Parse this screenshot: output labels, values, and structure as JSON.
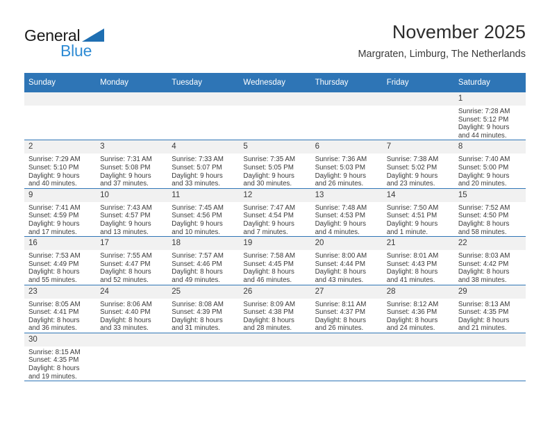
{
  "brand": {
    "name_top": "General",
    "name_bottom": "Blue",
    "accent_color": "#2e8bd4",
    "flag_color": "#1f6fb2"
  },
  "header": {
    "title": "November 2025",
    "subtitle": "Margraten, Limburg, The Netherlands"
  },
  "theme": {
    "header_blue": "#2e75b6",
    "daynum_band": "#f1f1f1",
    "text": "#3a3a3a"
  },
  "weekday_headers": [
    "Sunday",
    "Monday",
    "Tuesday",
    "Wednesday",
    "Thursday",
    "Friday",
    "Saturday"
  ],
  "labels": {
    "sunrise_prefix": "Sunrise:",
    "sunset_prefix": "Sunset:",
    "daylight_prefix": "Daylight:"
  },
  "weeks": [
    [
      {
        "day": "",
        "sunrise": "",
        "sunset": "",
        "daylight_1": "",
        "daylight_2": "",
        "empty": true
      },
      {
        "day": "",
        "sunrise": "",
        "sunset": "",
        "daylight_1": "",
        "daylight_2": "",
        "empty": true
      },
      {
        "day": "",
        "sunrise": "",
        "sunset": "",
        "daylight_1": "",
        "daylight_2": "",
        "empty": true
      },
      {
        "day": "",
        "sunrise": "",
        "sunset": "",
        "daylight_1": "",
        "daylight_2": "",
        "empty": true
      },
      {
        "day": "",
        "sunrise": "",
        "sunset": "",
        "daylight_1": "",
        "daylight_2": "",
        "empty": true
      },
      {
        "day": "",
        "sunrise": "",
        "sunset": "",
        "daylight_1": "",
        "daylight_2": "",
        "empty": true
      },
      {
        "day": "1",
        "sunrise": "Sunrise: 7:28 AM",
        "sunset": "Sunset: 5:12 PM",
        "daylight_1": "Daylight: 9 hours",
        "daylight_2": "and 44 minutes.",
        "empty": false
      }
    ],
    [
      {
        "day": "2",
        "sunrise": "Sunrise: 7:29 AM",
        "sunset": "Sunset: 5:10 PM",
        "daylight_1": "Daylight: 9 hours",
        "daylight_2": "and 40 minutes.",
        "empty": false
      },
      {
        "day": "3",
        "sunrise": "Sunrise: 7:31 AM",
        "sunset": "Sunset: 5:08 PM",
        "daylight_1": "Daylight: 9 hours",
        "daylight_2": "and 37 minutes.",
        "empty": false
      },
      {
        "day": "4",
        "sunrise": "Sunrise: 7:33 AM",
        "sunset": "Sunset: 5:07 PM",
        "daylight_1": "Daylight: 9 hours",
        "daylight_2": "and 33 minutes.",
        "empty": false
      },
      {
        "day": "5",
        "sunrise": "Sunrise: 7:35 AM",
        "sunset": "Sunset: 5:05 PM",
        "daylight_1": "Daylight: 9 hours",
        "daylight_2": "and 30 minutes.",
        "empty": false
      },
      {
        "day": "6",
        "sunrise": "Sunrise: 7:36 AM",
        "sunset": "Sunset: 5:03 PM",
        "daylight_1": "Daylight: 9 hours",
        "daylight_2": "and 26 minutes.",
        "empty": false
      },
      {
        "day": "7",
        "sunrise": "Sunrise: 7:38 AM",
        "sunset": "Sunset: 5:02 PM",
        "daylight_1": "Daylight: 9 hours",
        "daylight_2": "and 23 minutes.",
        "empty": false
      },
      {
        "day": "8",
        "sunrise": "Sunrise: 7:40 AM",
        "sunset": "Sunset: 5:00 PM",
        "daylight_1": "Daylight: 9 hours",
        "daylight_2": "and 20 minutes.",
        "empty": false
      }
    ],
    [
      {
        "day": "9",
        "sunrise": "Sunrise: 7:41 AM",
        "sunset": "Sunset: 4:59 PM",
        "daylight_1": "Daylight: 9 hours",
        "daylight_2": "and 17 minutes.",
        "empty": false
      },
      {
        "day": "10",
        "sunrise": "Sunrise: 7:43 AM",
        "sunset": "Sunset: 4:57 PM",
        "daylight_1": "Daylight: 9 hours",
        "daylight_2": "and 13 minutes.",
        "empty": false
      },
      {
        "day": "11",
        "sunrise": "Sunrise: 7:45 AM",
        "sunset": "Sunset: 4:56 PM",
        "daylight_1": "Daylight: 9 hours",
        "daylight_2": "and 10 minutes.",
        "empty": false
      },
      {
        "day": "12",
        "sunrise": "Sunrise: 7:47 AM",
        "sunset": "Sunset: 4:54 PM",
        "daylight_1": "Daylight: 9 hours",
        "daylight_2": "and 7 minutes.",
        "empty": false
      },
      {
        "day": "13",
        "sunrise": "Sunrise: 7:48 AM",
        "sunset": "Sunset: 4:53 PM",
        "daylight_1": "Daylight: 9 hours",
        "daylight_2": "and 4 minutes.",
        "empty": false
      },
      {
        "day": "14",
        "sunrise": "Sunrise: 7:50 AM",
        "sunset": "Sunset: 4:51 PM",
        "daylight_1": "Daylight: 9 hours",
        "daylight_2": "and 1 minute.",
        "empty": false
      },
      {
        "day": "15",
        "sunrise": "Sunrise: 7:52 AM",
        "sunset": "Sunset: 4:50 PM",
        "daylight_1": "Daylight: 8 hours",
        "daylight_2": "and 58 minutes.",
        "empty": false
      }
    ],
    [
      {
        "day": "16",
        "sunrise": "Sunrise: 7:53 AM",
        "sunset": "Sunset: 4:49 PM",
        "daylight_1": "Daylight: 8 hours",
        "daylight_2": "and 55 minutes.",
        "empty": false
      },
      {
        "day": "17",
        "sunrise": "Sunrise: 7:55 AM",
        "sunset": "Sunset: 4:47 PM",
        "daylight_1": "Daylight: 8 hours",
        "daylight_2": "and 52 minutes.",
        "empty": false
      },
      {
        "day": "18",
        "sunrise": "Sunrise: 7:57 AM",
        "sunset": "Sunset: 4:46 PM",
        "daylight_1": "Daylight: 8 hours",
        "daylight_2": "and 49 minutes.",
        "empty": false
      },
      {
        "day": "19",
        "sunrise": "Sunrise: 7:58 AM",
        "sunset": "Sunset: 4:45 PM",
        "daylight_1": "Daylight: 8 hours",
        "daylight_2": "and 46 minutes.",
        "empty": false
      },
      {
        "day": "20",
        "sunrise": "Sunrise: 8:00 AM",
        "sunset": "Sunset: 4:44 PM",
        "daylight_1": "Daylight: 8 hours",
        "daylight_2": "and 43 minutes.",
        "empty": false
      },
      {
        "day": "21",
        "sunrise": "Sunrise: 8:01 AM",
        "sunset": "Sunset: 4:43 PM",
        "daylight_1": "Daylight: 8 hours",
        "daylight_2": "and 41 minutes.",
        "empty": false
      },
      {
        "day": "22",
        "sunrise": "Sunrise: 8:03 AM",
        "sunset": "Sunset: 4:42 PM",
        "daylight_1": "Daylight: 8 hours",
        "daylight_2": "and 38 minutes.",
        "empty": false
      }
    ],
    [
      {
        "day": "23",
        "sunrise": "Sunrise: 8:05 AM",
        "sunset": "Sunset: 4:41 PM",
        "daylight_1": "Daylight: 8 hours",
        "daylight_2": "and 36 minutes.",
        "empty": false
      },
      {
        "day": "24",
        "sunrise": "Sunrise: 8:06 AM",
        "sunset": "Sunset: 4:40 PM",
        "daylight_1": "Daylight: 8 hours",
        "daylight_2": "and 33 minutes.",
        "empty": false
      },
      {
        "day": "25",
        "sunrise": "Sunrise: 8:08 AM",
        "sunset": "Sunset: 4:39 PM",
        "daylight_1": "Daylight: 8 hours",
        "daylight_2": "and 31 minutes.",
        "empty": false
      },
      {
        "day": "26",
        "sunrise": "Sunrise: 8:09 AM",
        "sunset": "Sunset: 4:38 PM",
        "daylight_1": "Daylight: 8 hours",
        "daylight_2": "and 28 minutes.",
        "empty": false
      },
      {
        "day": "27",
        "sunrise": "Sunrise: 8:11 AM",
        "sunset": "Sunset: 4:37 PM",
        "daylight_1": "Daylight: 8 hours",
        "daylight_2": "and 26 minutes.",
        "empty": false
      },
      {
        "day": "28",
        "sunrise": "Sunrise: 8:12 AM",
        "sunset": "Sunset: 4:36 PM",
        "daylight_1": "Daylight: 8 hours",
        "daylight_2": "and 24 minutes.",
        "empty": false
      },
      {
        "day": "29",
        "sunrise": "Sunrise: 8:13 AM",
        "sunset": "Sunset: 4:35 PM",
        "daylight_1": "Daylight: 8 hours",
        "daylight_2": "and 21 minutes.",
        "empty": false
      }
    ],
    [
      {
        "day": "30",
        "sunrise": "Sunrise: 8:15 AM",
        "sunset": "Sunset: 4:35 PM",
        "daylight_1": "Daylight: 8 hours",
        "daylight_2": "and 19 minutes.",
        "empty": false
      },
      {
        "day": "",
        "sunrise": "",
        "sunset": "",
        "daylight_1": "",
        "daylight_2": "",
        "empty": true
      },
      {
        "day": "",
        "sunrise": "",
        "sunset": "",
        "daylight_1": "",
        "daylight_2": "",
        "empty": true
      },
      {
        "day": "",
        "sunrise": "",
        "sunset": "",
        "daylight_1": "",
        "daylight_2": "",
        "empty": true
      },
      {
        "day": "",
        "sunrise": "",
        "sunset": "",
        "daylight_1": "",
        "daylight_2": "",
        "empty": true
      },
      {
        "day": "",
        "sunrise": "",
        "sunset": "",
        "daylight_1": "",
        "daylight_2": "",
        "empty": true
      },
      {
        "day": "",
        "sunrise": "",
        "sunset": "",
        "daylight_1": "",
        "daylight_2": "",
        "empty": true
      }
    ]
  ]
}
